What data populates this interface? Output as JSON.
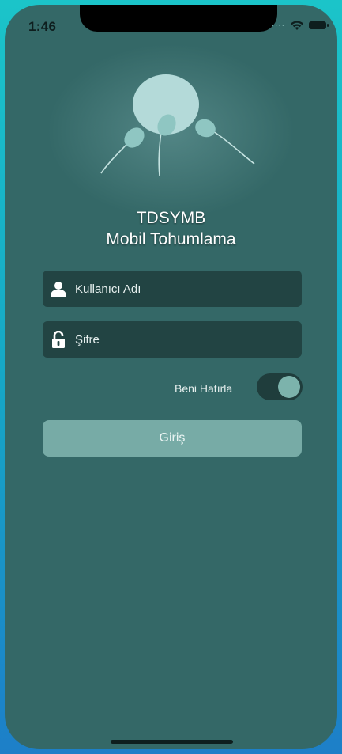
{
  "status_bar": {
    "time": "1:46",
    "signal_icon": "signal-dots-icon",
    "wifi_icon": "wifi-icon",
    "battery_icon": "battery-icon"
  },
  "app": {
    "title_line1": "TDSYMB",
    "title_line2": "Mobil Tohumlama",
    "logo_icon": "cell-logo-icon"
  },
  "login": {
    "username_placeholder": "Kullanıcı Adı",
    "username_value": "",
    "username_icon": "user-icon",
    "password_placeholder": "Şifre",
    "password_value": "",
    "password_icon": "lock-icon",
    "remember_label": "Beni Hatırla",
    "remember_on": true,
    "submit_label": "Giriş"
  },
  "colors": {
    "background": "#346867",
    "field_background": "#224443",
    "button_background": "#77aba6",
    "toggle_knob": "#7cb3ac",
    "logo_cell": "#b4dad9"
  }
}
